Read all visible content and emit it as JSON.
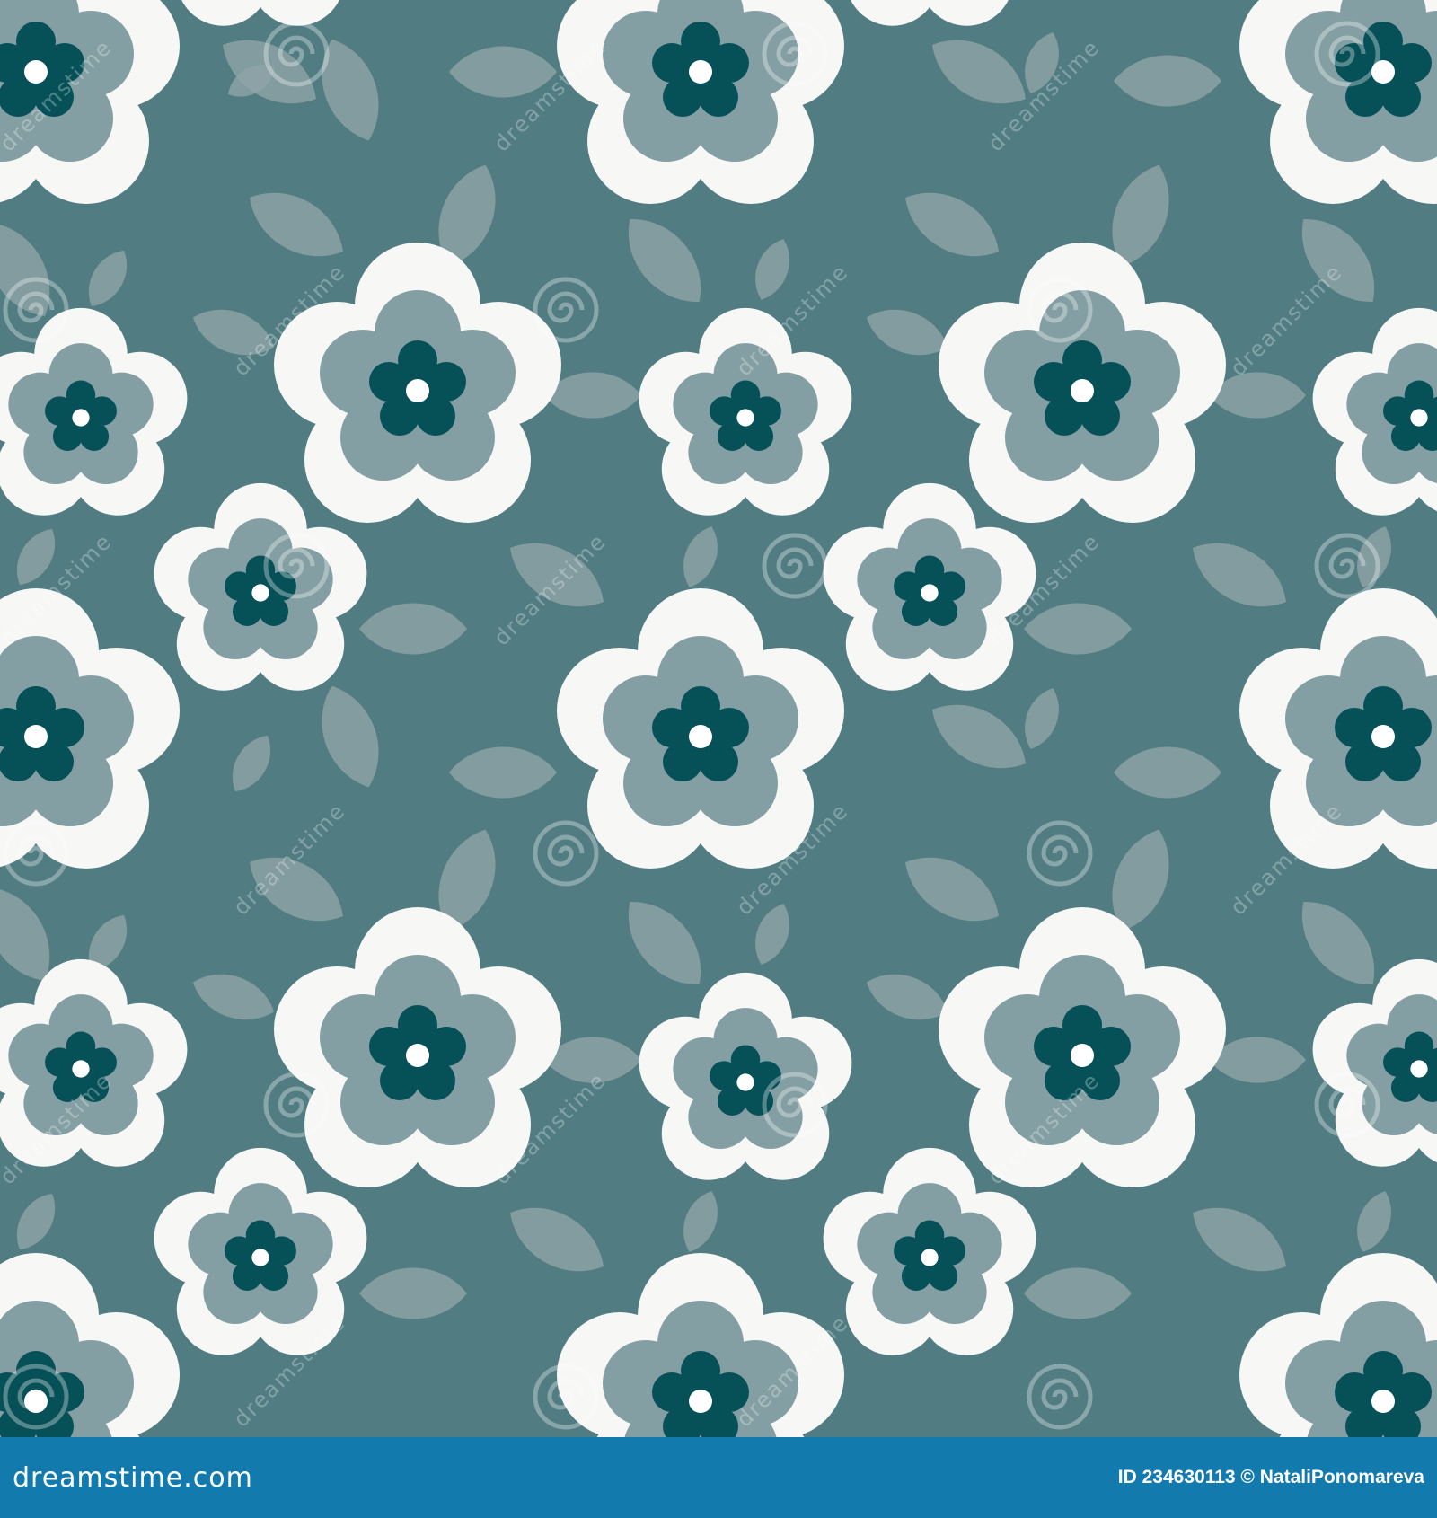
{
  "pattern": {
    "description": "Seamless floral pattern: white multi-layer flowers with dark teal centers and translucent leaves on a teal background",
    "colors": {
      "background": "#517d82",
      "leaf": "#8ea4a8",
      "petal_outer": "#f7f7f6",
      "petal_mid": "#849fa3",
      "petal_inner": "#065058",
      "center": "#ffffff",
      "footer_bar": "#137aae"
    },
    "watermark_text": "dreamstime",
    "watermark_icon": "spiral-watermark-icon"
  },
  "footer": {
    "brand": "dreamstime.com",
    "image_id": "ID 234630113",
    "copyright_symbol": "©",
    "author": "NataliPonomareva"
  }
}
